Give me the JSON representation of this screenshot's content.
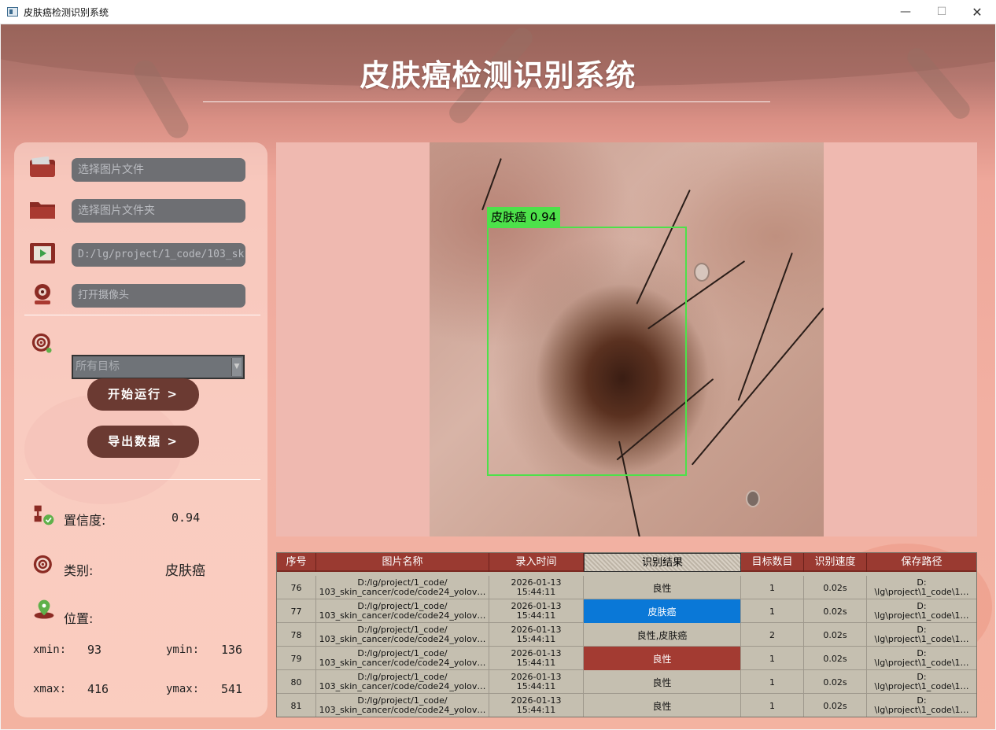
{
  "window": {
    "title": "皮肤癌检测识别系统",
    "minimize": "—",
    "maximize": "☐",
    "close": "✕"
  },
  "header": {
    "title": "皮肤癌检测识别系统"
  },
  "inputs": {
    "image_file": "选择图片文件",
    "image_folder": "选择图片文件夹",
    "video_path": "D:/lg/project/1_code/103_sk",
    "camera": "打开摄像头"
  },
  "target_select": {
    "value": "所有目标"
  },
  "buttons": {
    "start": "开始运行 >",
    "export": "导出数据 >"
  },
  "info": {
    "confidence_label": "置信度:",
    "confidence_value": "0.94",
    "class_label": "类别:",
    "class_value": "皮肤癌",
    "position_label": "位置:",
    "xmin_label": "xmin:",
    "xmin": "93",
    "ymin_label": "ymin:",
    "ymin": "136",
    "xmax_label": "xmax:",
    "xmax": "416",
    "ymax_label": "ymax:",
    "ymax": "541"
  },
  "detection": {
    "label": "皮肤癌 0.94",
    "box_color": "#4de14a"
  },
  "table": {
    "headers": [
      "序号",
      "图片名称",
      "录入时间",
      "识别结果",
      "目标数目",
      "识别速度",
      "保存路径"
    ],
    "rows": [
      {
        "no": "76",
        "name1": "D:/lg/project/1_code/",
        "name2": "103_skin_cancer/code/code24_yolov…",
        "date": "2026-01-13",
        "time": "15:44:11",
        "result": "良性",
        "count": "1",
        "speed": "0.02s",
        "path1": "D:",
        "path2": "\\lg\\project\\1_code\\1…"
      },
      {
        "no": "77",
        "name1": "D:/lg/project/1_code/",
        "name2": "103_skin_cancer/code/code24_yolov…",
        "date": "2026-01-13",
        "time": "15:44:11",
        "result": "皮肤癌",
        "count": "1",
        "speed": "0.02s",
        "path1": "D:",
        "path2": "\\lg\\project\\1_code\\1…"
      },
      {
        "no": "78",
        "name1": "D:/lg/project/1_code/",
        "name2": "103_skin_cancer/code/code24_yolov…",
        "date": "2026-01-13",
        "time": "15:44:11",
        "result": "良性,皮肤癌",
        "count": "2",
        "speed": "0.02s",
        "path1": "D:",
        "path2": "\\lg\\project\\1_code\\1…"
      },
      {
        "no": "79",
        "name1": "D:/lg/project/1_code/",
        "name2": "103_skin_cancer/code/code24_yolov…",
        "date": "2026-01-13",
        "time": "15:44:11",
        "result": "良性",
        "count": "1",
        "speed": "0.02s",
        "path1": "D:",
        "path2": "\\lg\\project\\1_code\\1…"
      },
      {
        "no": "80",
        "name1": "D:/lg/project/1_code/",
        "name2": "103_skin_cancer/code/code24_yolov…",
        "date": "2026-01-13",
        "time": "15:44:11",
        "result": "良性",
        "count": "1",
        "speed": "0.02s",
        "path1": "D:",
        "path2": "\\lg\\project\\1_code\\1…"
      },
      {
        "no": "81",
        "name1": "D:/lg/project/1_code/",
        "name2": "103_skin_cancer/code/code24_yolov…",
        "date": "2026-01-13",
        "time": "15:44:11",
        "result": "良性",
        "count": "1",
        "speed": "0.02s",
        "path1": "D:",
        "path2": "\\lg\\project\\1_code\\1…"
      }
    ]
  },
  "colors": {
    "accent_button": "#6b3a32",
    "table_header": "#9a3a31",
    "selected_cell": "#0a78d7",
    "highlight_cell": "#a33b32"
  }
}
